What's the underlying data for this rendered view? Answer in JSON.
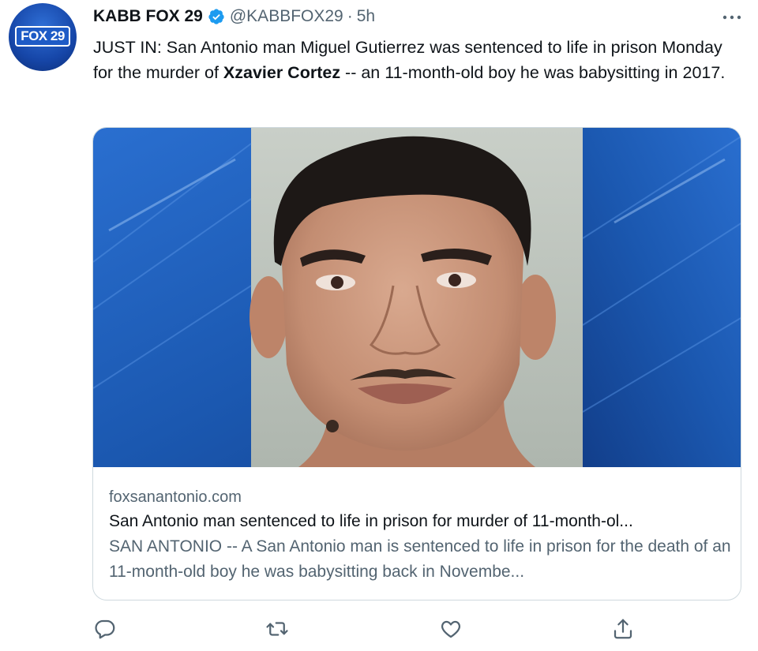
{
  "tweet": {
    "avatar_logo_text": "FOX 29",
    "display_name": "KABB FOX 29",
    "handle": "@KABBFOX29",
    "separator": "·",
    "time": "5h",
    "text_before": "JUST IN: San Antonio man Miguel Gutierrez was sentenced to life in prison Monday for the murder of ",
    "text_bold": "Xzavier Cortez",
    "text_after": " -- an 11-month-old boy he was babysitting in 2017."
  },
  "card": {
    "domain": "foxsanantonio.com",
    "title": "San Antonio man sentenced to life in prison for murder of 11-month-ol...",
    "description": "SAN ANTONIO -- A San Antonio man is sentenced to life in prison for the death of an 11-month-old boy he was babysitting back in Novembe..."
  },
  "icons": {
    "verified": "verified-badge-icon",
    "more": "more-options-icon",
    "reply": "reply-icon",
    "retweet": "retweet-icon",
    "like": "like-icon",
    "share": "share-icon"
  },
  "colors": {
    "text_primary": "#0f1419",
    "text_secondary": "#536471",
    "verified_blue": "#1d9bf0",
    "card_border": "#cfd9de",
    "media_blue": "#1a5fb4"
  }
}
